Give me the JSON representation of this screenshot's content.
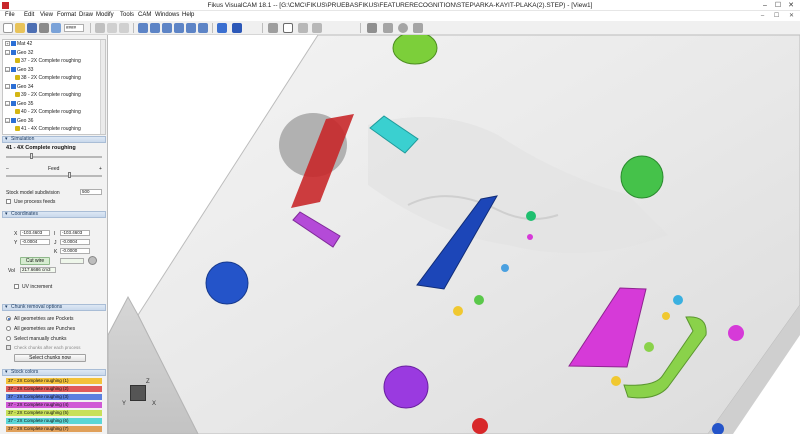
{
  "window": {
    "title": "Fikus VisualCAM 18.1 -- [G:\\CMC\\FIKUS\\PRUEBASFIKUS\\FEATURERECOGNITION\\STEP\\ARKA-KAYIT-PLAKA(2).STEP) - [View1]",
    "minimize": "–",
    "maximize": "☐",
    "close": "✕"
  },
  "menu": {
    "items": [
      "File",
      "Edit",
      "View",
      "Format",
      "Draw",
      "Modify",
      "Tools",
      "CAM",
      "Windows",
      "Help"
    ],
    "mdi_buttons": "– ☐ ✕"
  },
  "toolbar": {
    "icons": [
      "new-icon",
      "open-icon",
      "save-icon",
      "print-icon",
      "preview-icon",
      "cut-icon",
      "undo-icon",
      "redo-icon",
      "select-icon",
      "zoom-icon",
      "zoom-window-icon",
      "pan-icon",
      "rotate-icon",
      "fit-icon",
      "view-icon",
      "layers-icon",
      "shade-icon",
      "grid-icon",
      "snap-icon",
      "measure-icon",
      "calc-icon",
      "check-icon",
      "settings-icon",
      "simulate-icon"
    ],
    "zoom_field": "####"
  },
  "tree": {
    "items": [
      {
        "label": "Mat 42",
        "type": "geo",
        "depth": 0
      },
      {
        "label": "Geo 32",
        "type": "geo",
        "depth": 0
      },
      {
        "label": "37 - 2X Complete roughing",
        "type": "op",
        "depth": 1
      },
      {
        "label": "Geo 33",
        "type": "geo",
        "depth": 0
      },
      {
        "label": "38 - 2X Complete roughing",
        "type": "op",
        "depth": 1
      },
      {
        "label": "Geo 34",
        "type": "geo",
        "depth": 0
      },
      {
        "label": "39 - 2X Complete roughing",
        "type": "op",
        "depth": 1
      },
      {
        "label": "Geo 35",
        "type": "geo",
        "depth": 0
      },
      {
        "label": "40 - 2X Complete roughing",
        "type": "op",
        "depth": 1
      },
      {
        "label": "Geo 36",
        "type": "geo",
        "depth": 0
      },
      {
        "label": "41 - 4X Complete roughing",
        "type": "op",
        "depth": 1
      }
    ]
  },
  "operation": {
    "header": "Simulation",
    "title": "41 - 4X Complete roughing",
    "feed_label": "Feed",
    "feed_minus": "–",
    "feed_plus": "+",
    "subdivision_label": "Stock model subdivision",
    "subdivision_value": "500",
    "use_process_feeds": "Use process feeds"
  },
  "coordinates": {
    "header": "Coordinates",
    "x_label": "X",
    "x_value": "-103.4603",
    "y_label": "Y",
    "y_value": "-0.0004",
    "i_label": "I",
    "i_value": "-103.4603",
    "j_label": "J",
    "j_value": "-0.0004",
    "k_label": "K",
    "k_value": "-0.0000",
    "cut_wire": "Cut wire",
    "vol_label": "Vol",
    "vol_value": "217.6686 cm3",
    "uv_increment": "UV increment"
  },
  "chunk": {
    "header": "Chunk removal options",
    "opt_pockets": "All geometries are Pockets",
    "opt_punches": "All geometries are Punches",
    "opt_manual": "Select manually chunks",
    "check_after": "Check chunks after each process",
    "select_button": "Select chunks now"
  },
  "stock_colors": {
    "header": "Stock colors",
    "rows": [
      {
        "label": "37 - 2X Complete roughing (1)",
        "color": "#f3c23a"
      },
      {
        "label": "37 - 2X Complete roughing (2)",
        "color": "#e05a5a"
      },
      {
        "label": "37 - 2X Complete roughing (3)",
        "color": "#5b7fe0"
      },
      {
        "label": "37 - 2X Complete roughing (4)",
        "color": "#d05ad6"
      },
      {
        "label": "37 - 2X Complete roughing (5)",
        "color": "#c8e05a"
      },
      {
        "label": "37 - 2X Complete roughing (6)",
        "color": "#5ad6d6"
      },
      {
        "label": "37 - 2X Complete roughing (7)",
        "color": "#e0a05a"
      }
    ]
  },
  "axes": {
    "x": "X",
    "y": "Y",
    "z": "Z"
  },
  "colors": {
    "pocket_red": "#c8282a",
    "pocket_blue": "#1c46b8",
    "pocket_magenta": "#d63ad8",
    "pocket_green": "#7ccf3a",
    "pocket_cyan": "#3ad0d0",
    "pocket_purple": "#9a3ae0",
    "pocket_yellow": "#f0c830"
  }
}
